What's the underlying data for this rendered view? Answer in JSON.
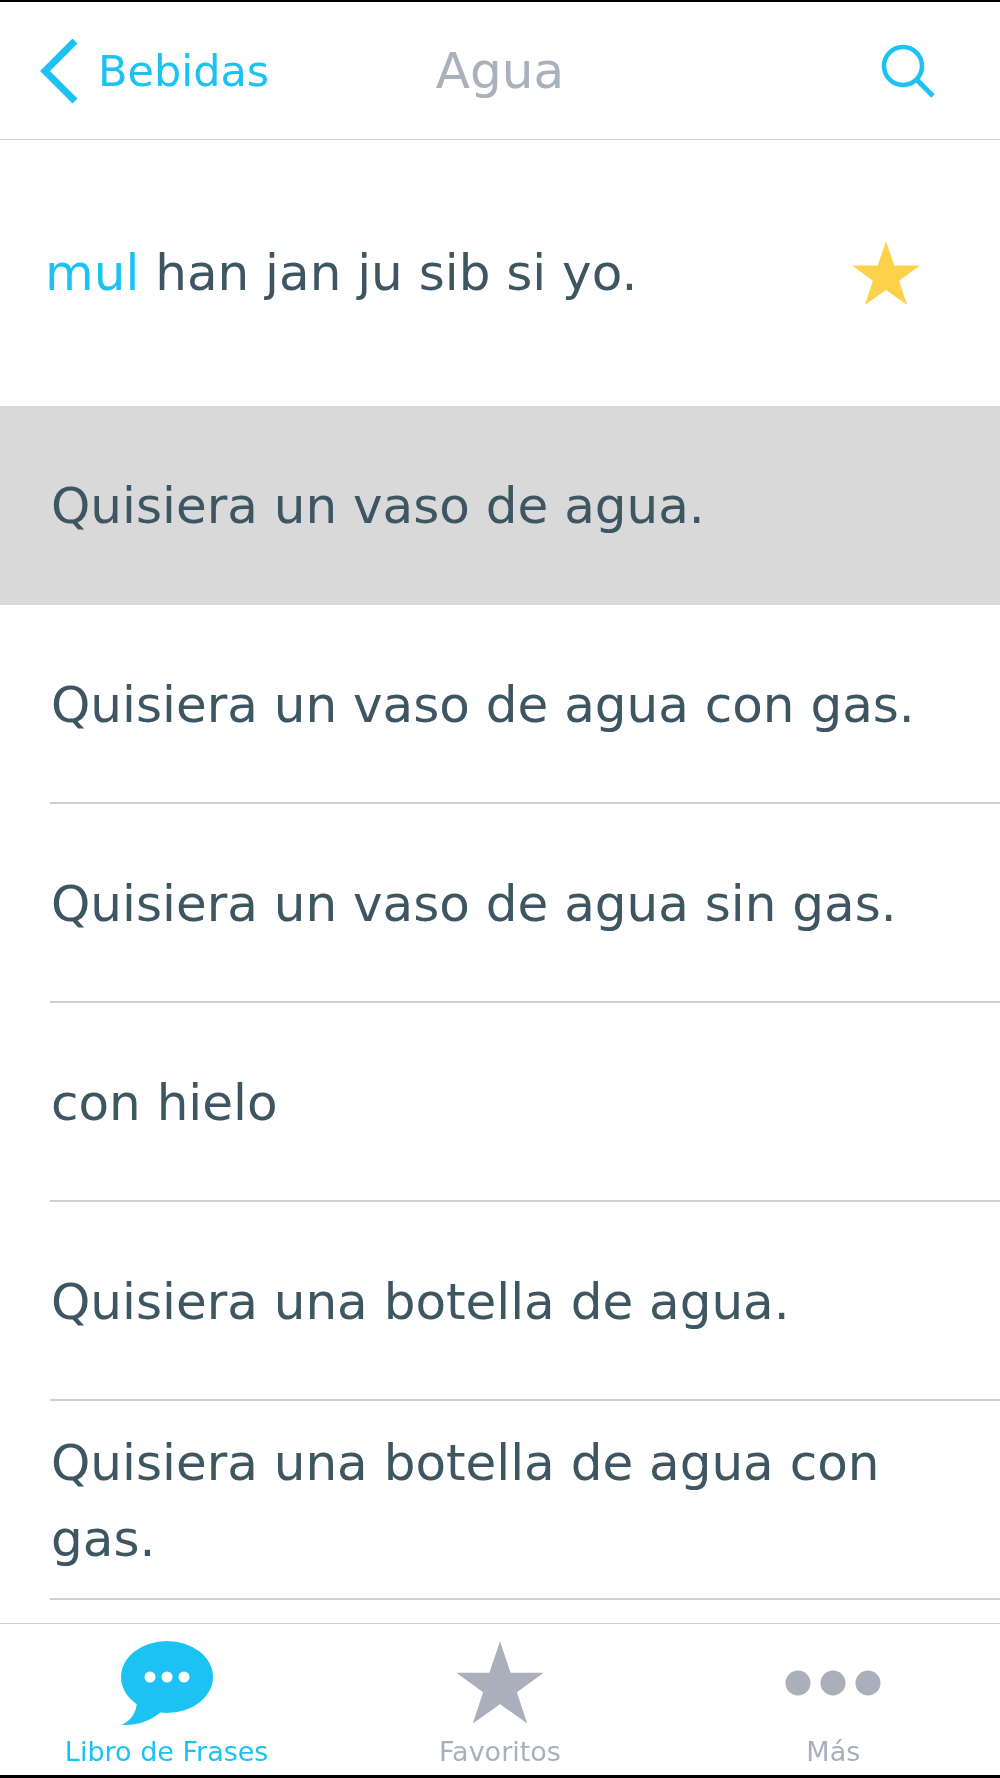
{
  "nav_bar": {
    "back_label": "Bebidas",
    "title": "Agua"
  },
  "phrase_header": {
    "parts": [
      {
        "text": "mul",
        "highlighted": true
      },
      {
        "text": "han jan ju sib si yo.",
        "highlighted": false
      }
    ],
    "favorite": true
  },
  "phrases": [
    {
      "text": "Quisiera un vaso de agua.",
      "selected": true
    },
    {
      "text": "Quisiera un vaso de agua con gas.",
      "selected": false
    },
    {
      "text": "Quisiera un vaso de agua sin gas.",
      "selected": false
    },
    {
      "text": "con hielo",
      "selected": false
    },
    {
      "text": "Quisiera una botella de agua.",
      "selected": false
    },
    {
      "text": "Quisiera una botella de agua con gas.",
      "selected": false
    }
  ],
  "tabs": [
    {
      "kind": "phrasebook",
      "label": "Libro de Frases",
      "selected": true
    },
    {
      "kind": "favorites",
      "label": "Favoritos",
      "selected": false
    },
    {
      "kind": "more",
      "label": "Más",
      "selected": false
    }
  ]
}
